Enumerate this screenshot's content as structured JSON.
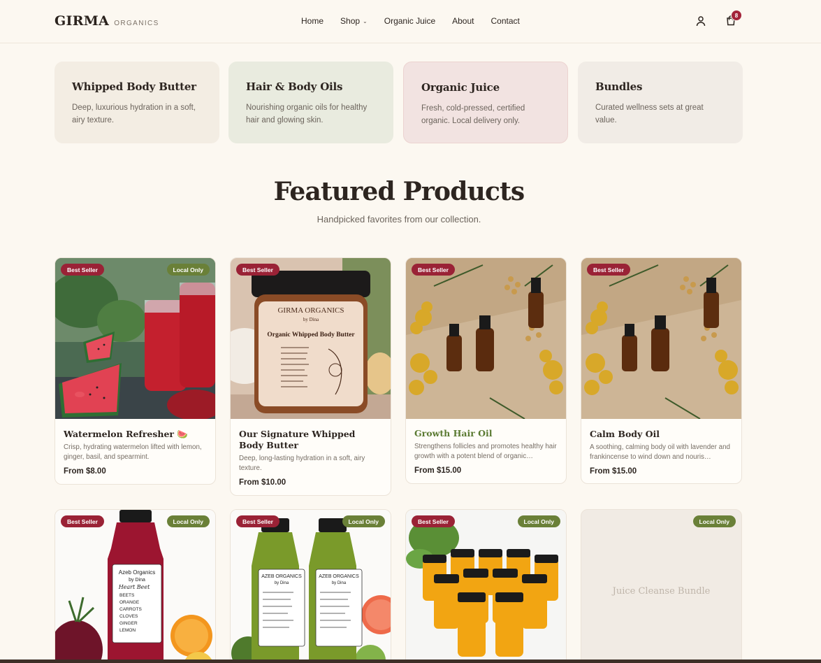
{
  "brand": {
    "name": "GIRMA",
    "tagline": "ORGANICS"
  },
  "nav": {
    "home": "Home",
    "shop": "Shop",
    "juice": "Organic Juice",
    "about": "About",
    "contact": "Contact"
  },
  "cart": {
    "count": "8"
  },
  "categories": [
    {
      "title": "Whipped Body Butter",
      "desc": "Deep, luxurious hydration in a soft, airy texture.",
      "bg": "#f3ede3"
    },
    {
      "title": "Hair & Body Oils",
      "desc": "Nourishing organic oils for healthy hair and glowing skin.",
      "bg": "#e9ebdf"
    },
    {
      "title": "Organic Juice",
      "desc": "Fresh, cold-pressed, certified organic. Local delivery only.",
      "bg": "#f2e3e1"
    },
    {
      "title": "Bundles",
      "desc": "Curated wellness sets at great value.",
      "bg": "#f1ece6"
    }
  ],
  "featured": {
    "title": "Featured Products",
    "subtitle": "Handpicked favorites from our collection."
  },
  "badges": {
    "best": "Best Seller",
    "local": "Local Only"
  },
  "products": [
    {
      "name": "Watermelon Refresher 🍉",
      "desc": "Crisp, hydrating watermelon lifted with lemon, ginger, basil, and spearmint.",
      "price": "From $8.00"
    },
    {
      "name": "Our Signature Whipped Body Butter",
      "desc": "Deep, long-lasting hydration in a soft, airy texture.",
      "price": "From $10.00",
      "jar_brand": "GIRMA ORGANICS",
      "jar_by": "by Dina",
      "jar_title": "Organic Whipped Body Butter"
    },
    {
      "name": "Growth Hair Oil",
      "desc": "Strengthens follicles and promotes healthy hair growth with a potent blend of organic…",
      "price": "From $15.00"
    },
    {
      "name": "Calm Body Oil",
      "desc": "A soothing, calming body oil with lavender and frankincense to wind down and nouris…",
      "price": "From $15.00"
    },
    {
      "label_brand": "Azeb Organics",
      "label_by": "by Dina",
      "label_name": "Heart Beet",
      "label_items": [
        "BEETS",
        "ORANGE",
        "CARROTS",
        "CLOVES",
        "GINGER",
        "LEMON"
      ]
    },
    {
      "label_brand": "AZEB ORGANICS",
      "label_by": "by Dina"
    },
    {},
    {
      "placeholder": "Juice Cleanse Bundle"
    }
  ]
}
